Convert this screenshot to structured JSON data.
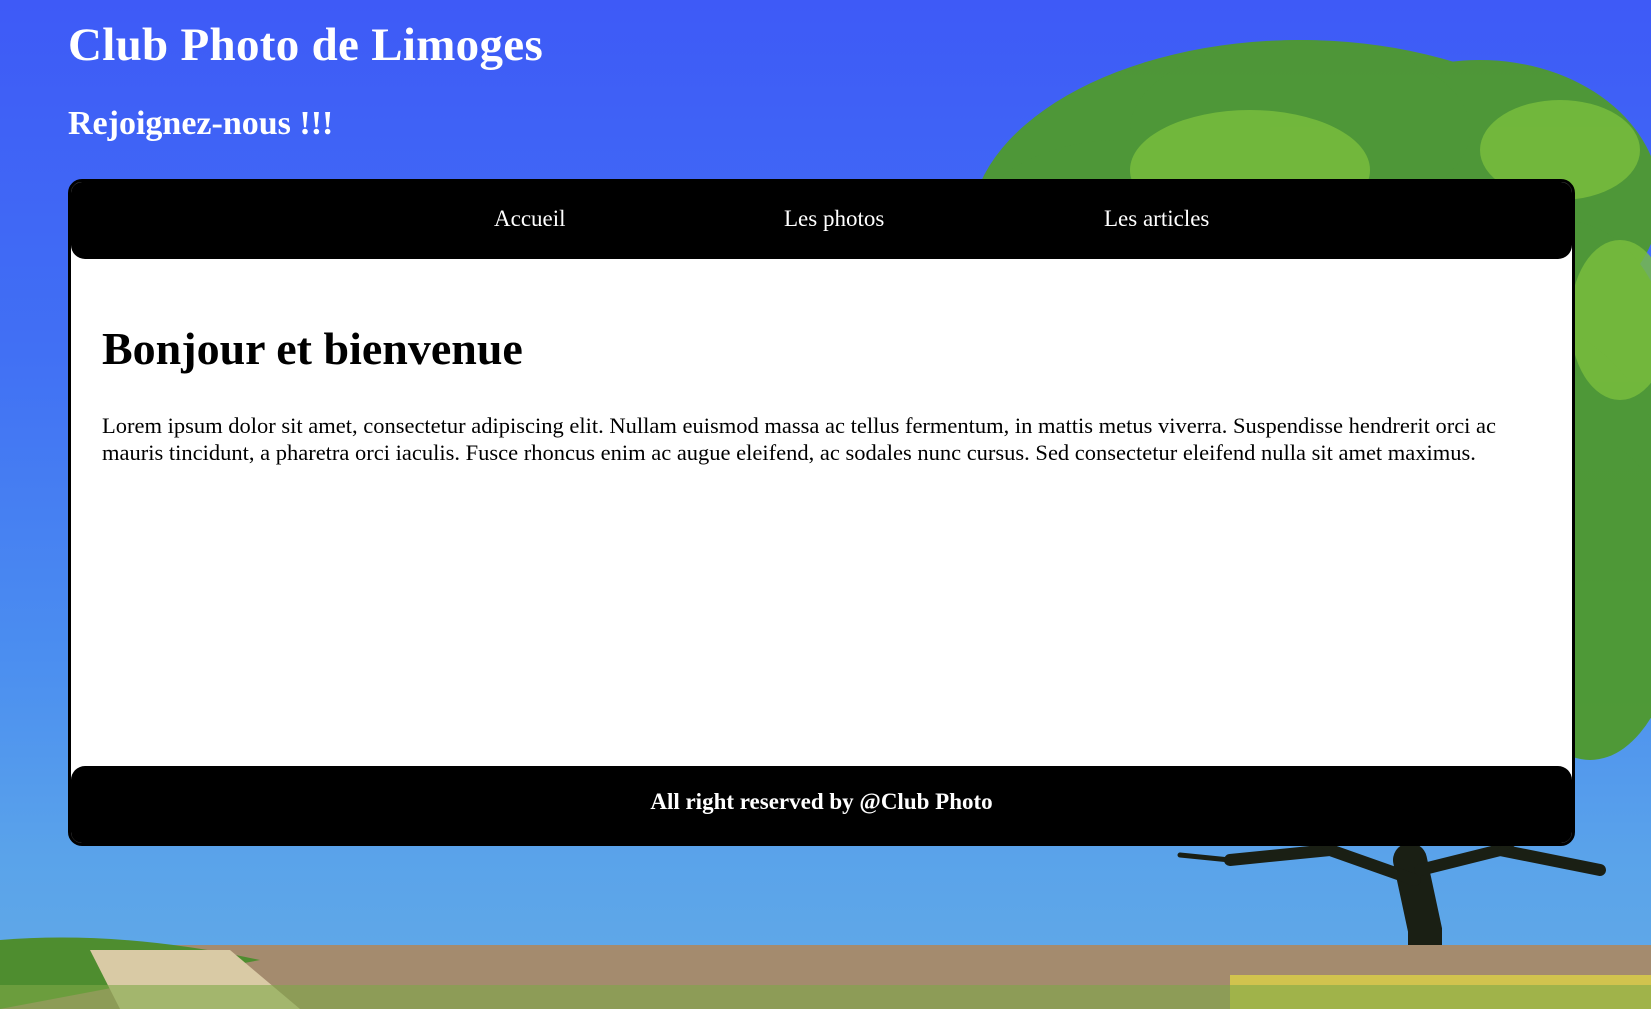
{
  "header": {
    "title": "Club Photo de Limoges",
    "subtitle": "Rejoignez-nous !!!"
  },
  "nav": {
    "items": [
      {
        "label": "Accueil"
      },
      {
        "label": "Les photos"
      },
      {
        "label": "Les articles"
      }
    ]
  },
  "main": {
    "heading": "Bonjour et bienvenue",
    "paragraph": "Lorem ipsum dolor sit amet, consectetur adipiscing elit. Nullam euismod massa ac tellus fermentum, in mattis metus viverra. Suspendisse hendrerit orci ac mauris tincidunt, a pharetra orci iaculis. Fusce rhoncus enim ac augue eleifend, ac sodales nunc cursus. Sed consectetur eleifend nulla sit amet maximus."
  },
  "footer": {
    "text": "All right reserved by @Club Photo"
  },
  "colors": {
    "sky": "#3e5af7",
    "nav_bg": "#000000",
    "content_bg": "#ffffff"
  }
}
